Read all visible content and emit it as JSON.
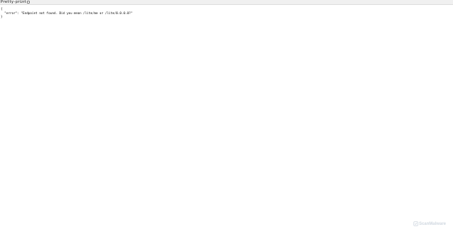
{
  "toolbar": {
    "pretty_print_label": "Pretty-print",
    "pretty_print_checked": false
  },
  "response": {
    "line1": "{",
    "line2": "  \"error\": \"Endpoint not found. Did you mean /lite/me or /lite/0.0.0.0?\"",
    "line3": "}"
  },
  "watermark": {
    "text": "ScanMalware",
    "icon": "scanmalware-logo-icon"
  }
}
